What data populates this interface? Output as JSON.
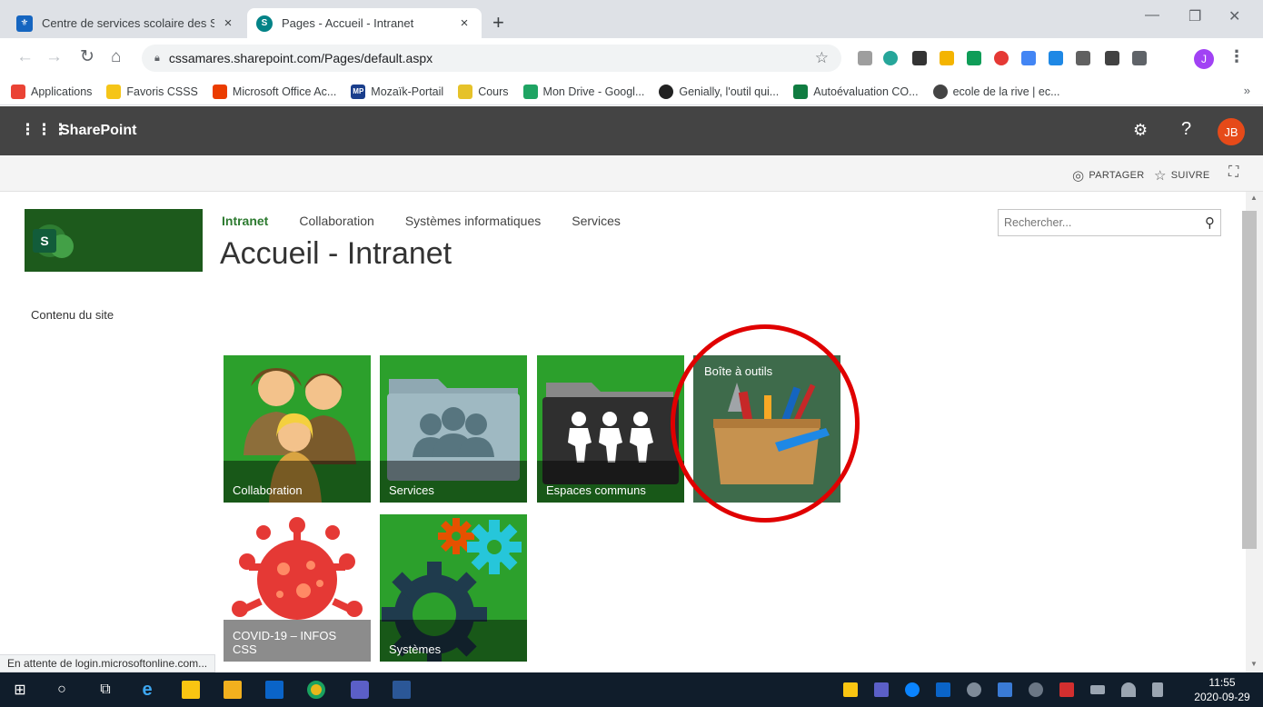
{
  "browser": {
    "tabs": [
      {
        "title": "Centre de services scolaire des Sa",
        "close": "×"
      },
      {
        "title": "Pages - Accueil - Intranet",
        "close": "×"
      }
    ],
    "new_tab": "+",
    "url": "cssamares.sharepoint.com/Pages/default.aspx",
    "profile_initial": "J",
    "bookmarks": [
      {
        "label": "Applications",
        "color": "#fbbc05"
      },
      {
        "label": "Favoris CSSS",
        "color": "#f5c518"
      },
      {
        "label": "Microsoft Office Ac...",
        "color": "#eb3c00"
      },
      {
        "label": "Mozaïk-Portail",
        "color": "#1a3e8c",
        "badge": "MP"
      },
      {
        "label": "Cours",
        "color": "#e6c229"
      },
      {
        "label": "Mon Drive - Googl...",
        "color": "#1fa463"
      },
      {
        "label": "Genially, l'outil qui...",
        "color": "#222222"
      },
      {
        "label": "Autoévaluation CO...",
        "color": "#107c41"
      },
      {
        "label": "ecole de la rive | ec...",
        "color": "#444444"
      }
    ],
    "bookmarks_more": "»",
    "status_text": "En attente de login.microsoftonline.com..."
  },
  "suite": {
    "brand": "SharePoint",
    "avatar_initials": "JB",
    "help": "?"
  },
  "ribbon": {
    "share": "PARTAGER",
    "follow": "SUIVRE"
  },
  "site": {
    "logo_letter": "S",
    "nav": [
      "Intranet",
      "Collaboration",
      "Systèmes informatiques",
      "Services"
    ],
    "title": "Accueil - Intranet",
    "search_placeholder": "Rechercher...",
    "quicklaunch": "Contenu du site"
  },
  "tiles": [
    {
      "label": "Collaboration"
    },
    {
      "label": "Services"
    },
    {
      "label": "Espaces communs"
    },
    {
      "label": "Boîte à outils"
    },
    {
      "label": "COVID-19 – INFOS CSS"
    },
    {
      "label": "Systèmes"
    }
  ],
  "taskbar": {
    "time": "11:55",
    "date": "2020-09-29"
  }
}
